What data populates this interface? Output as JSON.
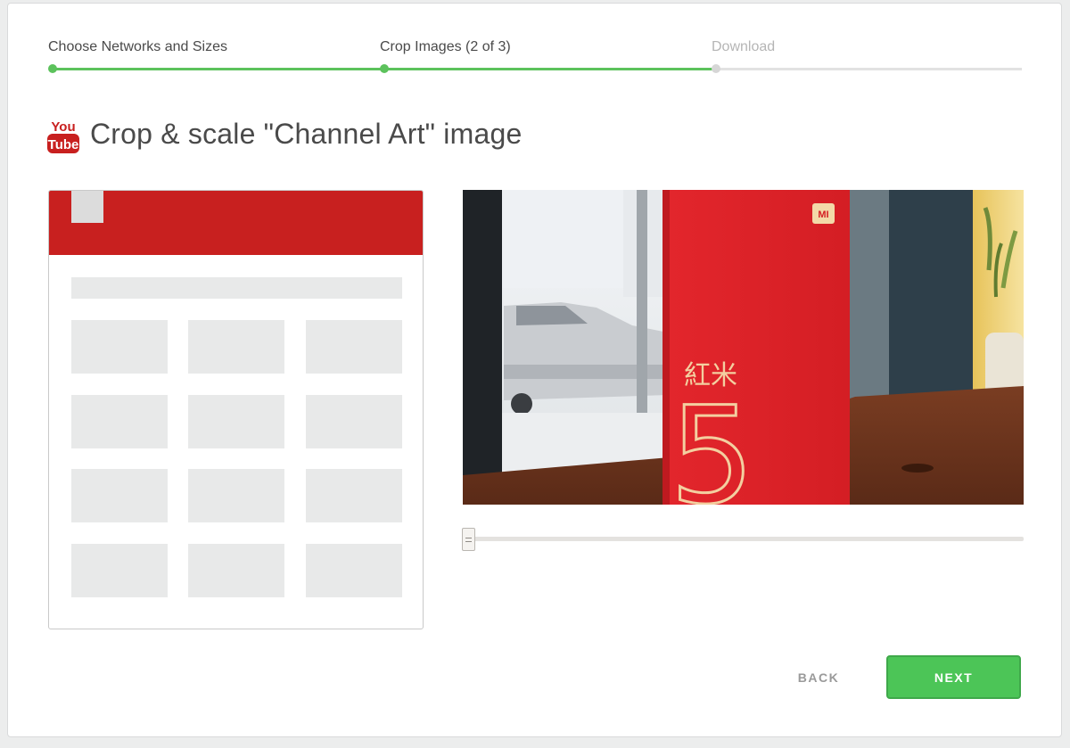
{
  "stepper": {
    "steps": [
      {
        "label": "Choose Networks and Sizes",
        "state": "done"
      },
      {
        "label": "Crop Images (2 of 3)",
        "state": "current"
      },
      {
        "label": "Download",
        "state": "todo"
      }
    ],
    "colors": {
      "done": "#5cc25c",
      "todo": "#e2e2e2"
    }
  },
  "heading": {
    "logo": {
      "top": "You",
      "bottom": "Tube",
      "icon": "youtube-logo-icon"
    },
    "title": "Crop & scale \"Channel Art\" image"
  },
  "preview": {
    "banner_color": "#c8201f",
    "thumbnail_grid": {
      "rows": 4,
      "columns": 3
    }
  },
  "crop_image": {
    "box_logo": "MI",
    "box_chars": "紅米",
    "box_number": "5"
  },
  "zoom_slider": {
    "value": 0
  },
  "actions": {
    "back_label": "BACK",
    "next_label": "NEXT",
    "next_color": "#4cc557"
  }
}
